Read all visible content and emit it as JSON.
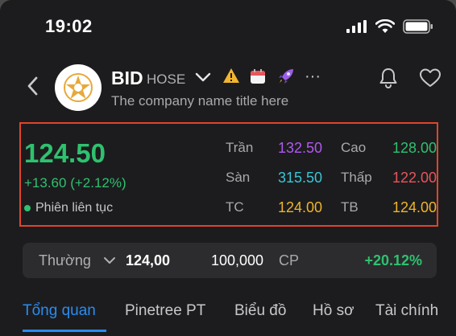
{
  "status_bar": {
    "time": "19:02"
  },
  "header": {
    "ticker": "BID",
    "exchange": "HOSE",
    "company_name": "The company name title here",
    "more": "···",
    "icons": [
      "back-chevron-icon",
      "company-logo",
      "chevron-down-icon",
      "warning-icon",
      "calendar-icon",
      "rocket-icon",
      "more-icon",
      "bell-icon",
      "heart-icon"
    ]
  },
  "quote": {
    "price": "124.50",
    "change": "+13.60 (+2.12%)",
    "session": "Phiên liên tục",
    "stats": {
      "ceiling": {
        "label": "Trần",
        "value": "132.50",
        "color": "#b157f0"
      },
      "floor": {
        "label": "Sàn",
        "value": "315.50",
        "color": "#38c6d8"
      },
      "reference": {
        "label": "TC",
        "value": "124.00",
        "color": "#f0b429"
      },
      "high": {
        "label": "Cao",
        "value": "128.00",
        "color": "#2fc16f"
      },
      "low": {
        "label": "Thấp",
        "value": "122.00",
        "color": "#e8555a"
      },
      "average": {
        "label": "TB",
        "value": "124.00",
        "color": "#f0b429"
      }
    }
  },
  "order": {
    "type": "Thường",
    "price": "124,00",
    "quantity": "100,000",
    "unit": "CP",
    "percent": "+20.12%"
  },
  "tabs": [
    {
      "label": "Tổng quan",
      "active": true
    },
    {
      "label": "Pinetree PT",
      "active": false
    },
    {
      "label": "Biểu đồ",
      "active": false
    },
    {
      "label": "Hồ sơ",
      "active": false
    },
    {
      "label": "Tài chính",
      "active": false
    }
  ],
  "colors": {
    "accent": "#2a8cf0",
    "up": "#2fc16f",
    "highlight_border": "#e0452b",
    "background": "#1c1c1e"
  }
}
